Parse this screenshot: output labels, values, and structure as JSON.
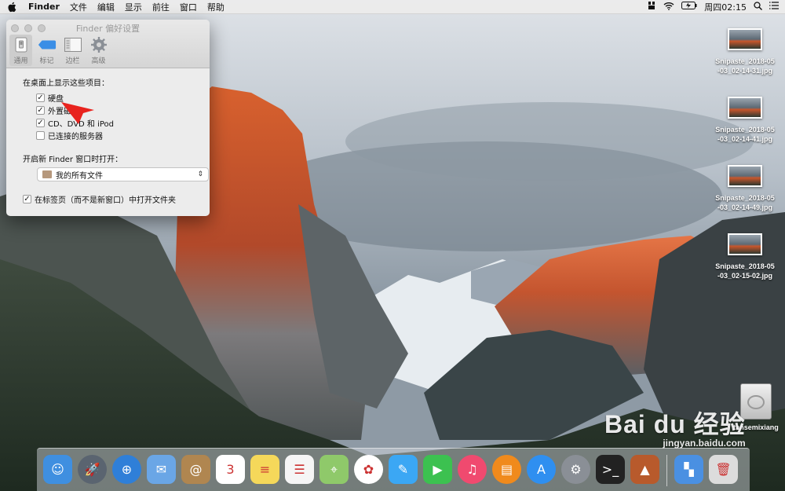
{
  "menubar": {
    "apple_icon": "apple-icon",
    "app_name": "Finder",
    "items": [
      "文件",
      "编辑",
      "显示",
      "前往",
      "窗口",
      "帮助"
    ],
    "clock": "周四02:15",
    "status_icons": [
      "bear-icon",
      "wifi-icon",
      "battery-icon",
      "search-icon",
      "list-icon"
    ]
  },
  "window": {
    "title": "Finder 偏好设置",
    "tabs": [
      {
        "label": "通用",
        "icon": "general-switch-icon",
        "active": true
      },
      {
        "label": "标记",
        "icon": "tag-icon",
        "active": false
      },
      {
        "label": "边栏",
        "icon": "sidebar-icon",
        "active": false
      },
      {
        "label": "高级",
        "icon": "gear-icon",
        "active": false
      }
    ],
    "desktop_section_title": "在桌面上显示这些项目：",
    "desktop_items": [
      {
        "label": "硬盘",
        "checked": true
      },
      {
        "label": "外置磁盘",
        "checked": true
      },
      {
        "label": "CD、DVD 和 iPod",
        "checked": true
      },
      {
        "label": "已连接的服务器",
        "checked": false
      }
    ],
    "new_window_title": "开启新 Finder 窗口时打开：",
    "new_window_value": "我的所有文件",
    "tabs_option": {
      "label": "在标签页（而不是新窗口）中打开文件夹",
      "checked": true
    }
  },
  "desktop": {
    "files": [
      {
        "line1": "Snipaste_2018-05",
        "line2": "-03_02-14-31.jpg"
      },
      {
        "line1": "Snipaste_2018-05",
        "line2": "-03_02-14-41.jpg"
      },
      {
        "line1": "Snipaste_2018-05",
        "line2": "-03_02-14-49.jpg"
      },
      {
        "line1": "Snipaste_2018-05",
        "line2": "-03_02-15-02.jpg"
      }
    ],
    "drive_label": "tansemixiang"
  },
  "dock": {
    "apps": [
      {
        "name": "finder-icon",
        "color": "#3f8fe0",
        "glyph": "☺"
      },
      {
        "name": "launchpad-icon",
        "color": "#5a6470",
        "glyph": "🚀"
      },
      {
        "name": "safari-icon",
        "color": "#2f7fd8",
        "glyph": "⊕"
      },
      {
        "name": "mail-icon",
        "color": "#6aa6e6",
        "glyph": "✉"
      },
      {
        "name": "contacts-icon",
        "color": "#b08650",
        "glyph": "@"
      },
      {
        "name": "calendar-icon",
        "color": "#ffffff",
        "glyph": "3"
      },
      {
        "name": "notes-icon",
        "color": "#f5d85a",
        "glyph": "≡"
      },
      {
        "name": "reminders-icon",
        "color": "#f5f5f5",
        "glyph": "☰"
      },
      {
        "name": "maps-icon",
        "color": "#8fc96a",
        "glyph": "⌖"
      },
      {
        "name": "photos-icon",
        "color": "#ffffff",
        "glyph": "✿"
      },
      {
        "name": "messages-icon",
        "color": "#3ba7f4",
        "glyph": "✎"
      },
      {
        "name": "facetime-icon",
        "color": "#3cc150",
        "glyph": "▶"
      },
      {
        "name": "itunes-icon",
        "color": "#f04a6f",
        "glyph": "♫"
      },
      {
        "name": "ibooks-icon",
        "color": "#f08a1c",
        "glyph": "▤"
      },
      {
        "name": "app-store-icon",
        "color": "#2f8ff0",
        "glyph": "A"
      },
      {
        "name": "system-preferences-icon",
        "color": "#8a8f96",
        "glyph": "⚙"
      },
      {
        "name": "terminal-icon",
        "color": "#222222",
        "glyph": ">_"
      },
      {
        "name": "el-capitan-installer-icon",
        "color": "#b85a2c",
        "glyph": "▲"
      },
      {
        "name": "maps-folder-icon",
        "color": "#4a90e2",
        "glyph": "▚"
      },
      {
        "name": "trash-icon",
        "color": "#dcdcdc",
        "glyph": "🗑"
      }
    ]
  },
  "watermark": {
    "main": "Bai du 经验",
    "sub": "jingyan.baidu.com"
  }
}
